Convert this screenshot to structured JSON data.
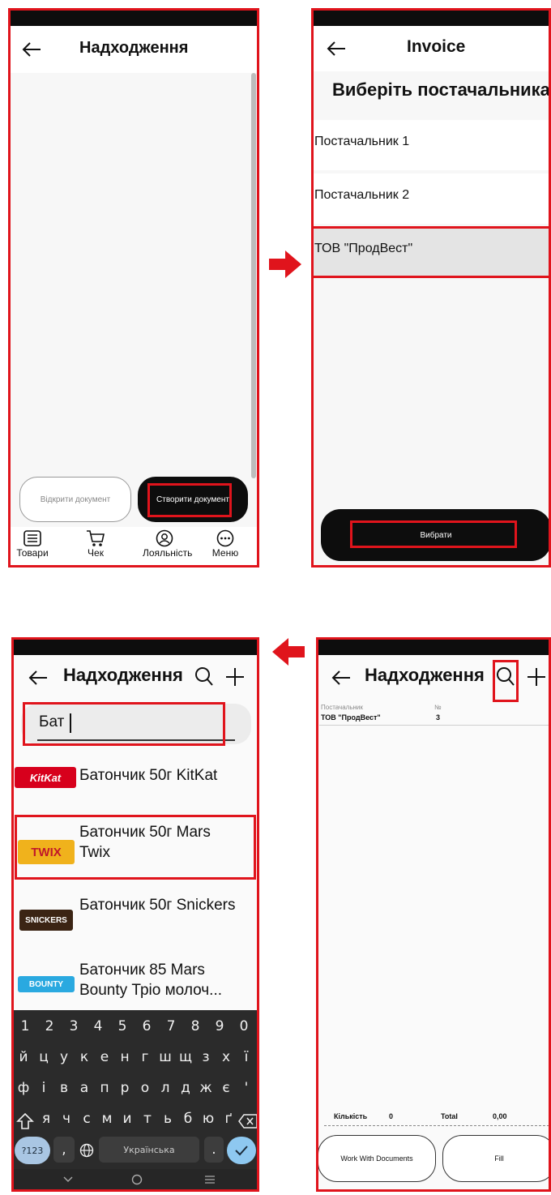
{
  "panel1": {
    "title": "Надходження",
    "open_doc": "Відкрити документ",
    "create_doc": "Створити документ",
    "nav": [
      "Товари",
      "Чек",
      "Лояльність",
      "Меню"
    ]
  },
  "panel2": {
    "title": "Invoice",
    "subtitle": "Виберіть постачальника",
    "suppliers": [
      "Постачальник 1",
      "Постачальник 2",
      "ТОВ \"ПродВест\""
    ],
    "select_button": "Вибрати"
  },
  "panel3": {
    "title": "Надходження",
    "search_value": "Бат",
    "products": [
      "Батончик 50г KitKat",
      "Батончик 50г Mars Twix",
      "Батончик 50г Snickers",
      "Батончик 85 Mars Bounty Тріо молоч..."
    ],
    "product_logos": [
      "KitKat",
      "TWIX",
      "SNICKERS",
      "BOUNTY"
    ],
    "keyboard": {
      "row1": [
        "1",
        "2",
        "3",
        "4",
        "5",
        "6",
        "7",
        "8",
        "9",
        "0"
      ],
      "row2": [
        "й",
        "ц",
        "у",
        "к",
        "е",
        "н",
        "г",
        "ш",
        "щ",
        "з",
        "х",
        "ї"
      ],
      "row3": [
        "ф",
        "і",
        "в",
        "а",
        "п",
        "р",
        "о",
        "л",
        "д",
        "ж",
        "є",
        "'"
      ],
      "row4": [
        "я",
        "ч",
        "с",
        "м",
        "и",
        "т",
        "ь",
        "б",
        "ю",
        "ґ"
      ],
      "sym_key": "?123",
      "comma": ",",
      "space_label": "Українська",
      "period": "."
    }
  },
  "panel4": {
    "title": "Надходження",
    "supplier_label": "Постачальник",
    "number_label": "№",
    "supplier_value": "ТОВ \"ПродВест\"",
    "number_value": "3",
    "qty_label": "Кількість",
    "qty_value": "0",
    "total_label": "Total",
    "total_value": "0,00",
    "work_button": "Work With Documents",
    "fill_button": "Fill"
  },
  "colors": {
    "accent": "#e0141c",
    "dark": "#0d0d0d",
    "keyboard": "#2b2b2b",
    "confirm": "#8ec8f0"
  }
}
